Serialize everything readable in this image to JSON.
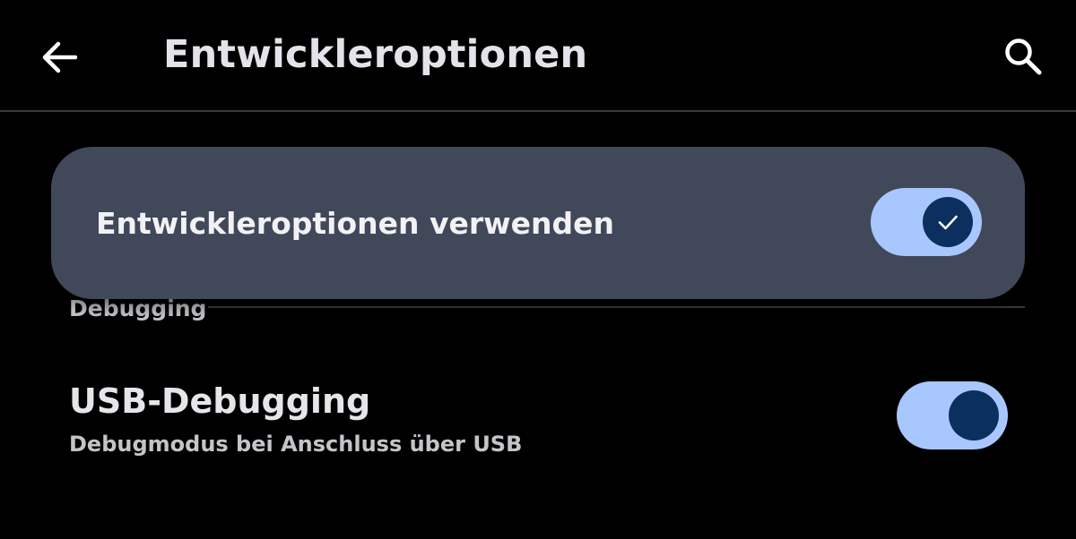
{
  "app_bar": {
    "title": "Entwickleroptionen",
    "back_icon": "arrow-back-icon",
    "search_icon": "search-icon"
  },
  "master_switch": {
    "label": "Entwickleroptionen verwenden",
    "checked": true,
    "check_icon": "check-icon"
  },
  "sections": [
    {
      "header": "Debugging",
      "items": [
        {
          "title": "USB-Debugging",
          "summary": "Debugmodus bei Anschluss über USB",
          "checked": true
        }
      ]
    }
  ],
  "colors": {
    "background": "#000000",
    "card": "#404859",
    "switch_track": "#a9c7ff",
    "switch_thumb": "#0b2f5f",
    "primary_text": "#e6e6ea",
    "secondary_text": "#c4c4c9"
  }
}
